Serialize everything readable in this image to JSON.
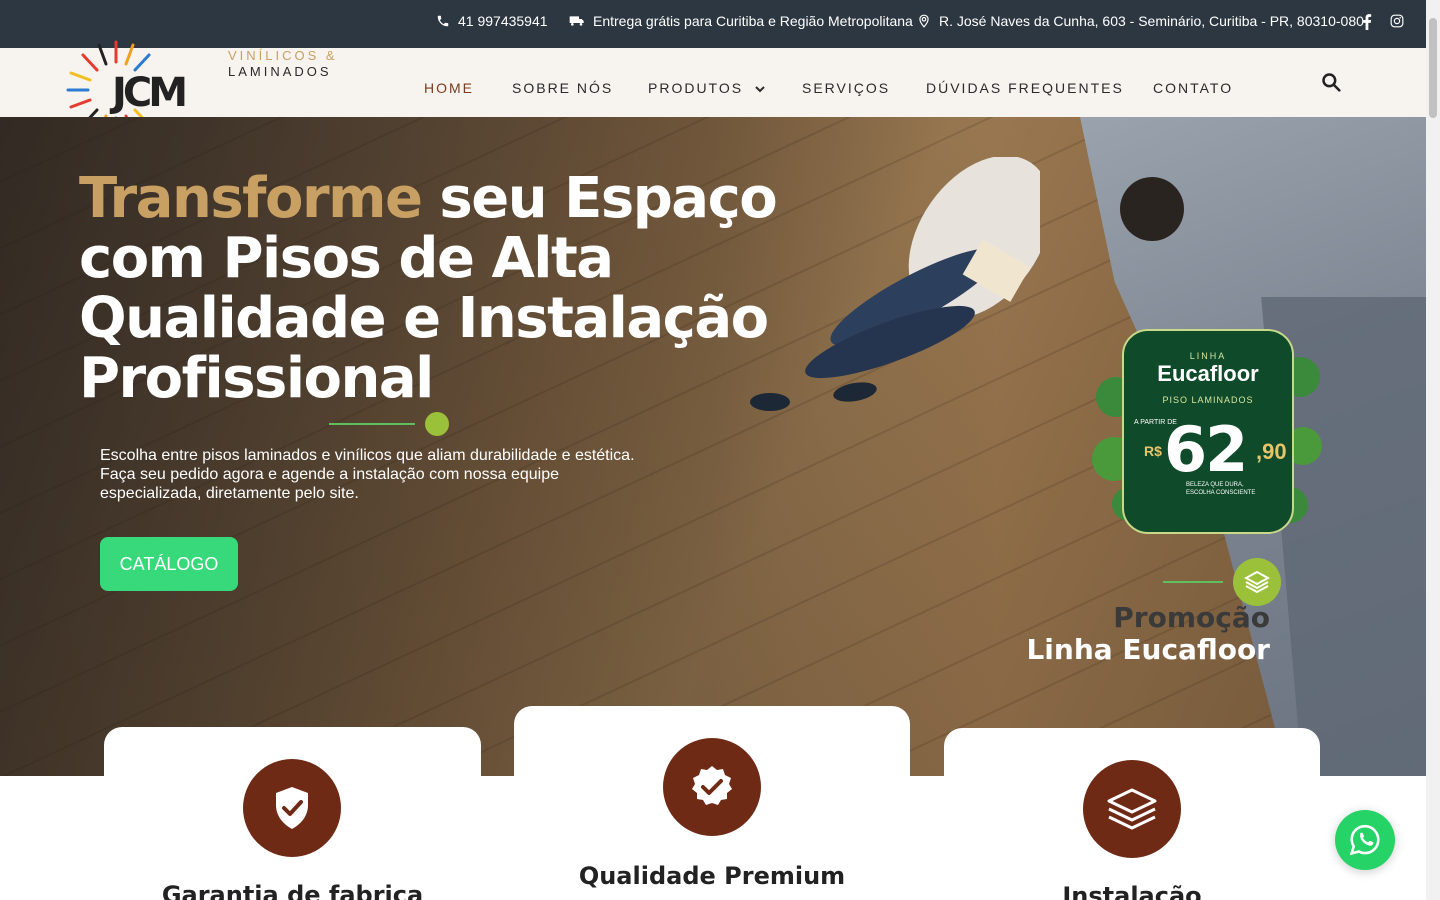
{
  "topbar": {
    "phone": "41 997435941",
    "delivery": "Entrega grátis para Curitiba e Região Metropolitana",
    "address": "R. José Naves da Cunha, 603 - Seminário, Curitiba - PR, 80310-080"
  },
  "logo": {
    "mark": "JCM",
    "line1": "VINÍLICOS &",
    "line2": "LAMINADOS"
  },
  "nav": {
    "home": "HOME",
    "about": "SOBRE NÓS",
    "products": "PRODUTOS",
    "services": "SERVIÇOS",
    "faq": "DÚVIDAS FREQUENTES",
    "contact": "CONTATO"
  },
  "hero": {
    "title_highlight": "Transforme",
    "title_rest_1": " seu Espaço",
    "title_line2": "com Pisos de Alta",
    "title_line3": "Qualidade e Instalação",
    "title_line4": "Profissional",
    "description": "Escolha entre pisos laminados e vinílicos que aliam durabilidade e estética. Faça seu pedido agora e agende a instalação com nossa equipe especializada, diretamente pelo site.",
    "cta": "CATÁLOGO"
  },
  "badge": {
    "line": "LINHA",
    "brand": "Eucafloor",
    "category": "PISO LAMINADOS",
    "from": "A PARTIR DE",
    "currency": "R$",
    "price": "62",
    "cents": ",90",
    "slogan_1": "BELEZA QUE DURA,",
    "slogan_2": "ESCOLHA CONSCIENTE"
  },
  "promo": {
    "line1": "Promoção",
    "line2": "Linha Eucafloor"
  },
  "features": [
    {
      "title": "Garantia de fabrica",
      "icon": "shield-check-icon"
    },
    {
      "title": "Qualidade Premium",
      "icon": "badge-check-icon"
    },
    {
      "title": "Instalação",
      "icon": "layers-icon"
    }
  ],
  "colors": {
    "topbar": "#2d3741",
    "header": "#f7f3ee",
    "gold": "#c8a064",
    "brown": "#6e2a14",
    "green_cta": "#38d97a",
    "lime": "#9bc13a",
    "whatsapp": "#25d366"
  }
}
